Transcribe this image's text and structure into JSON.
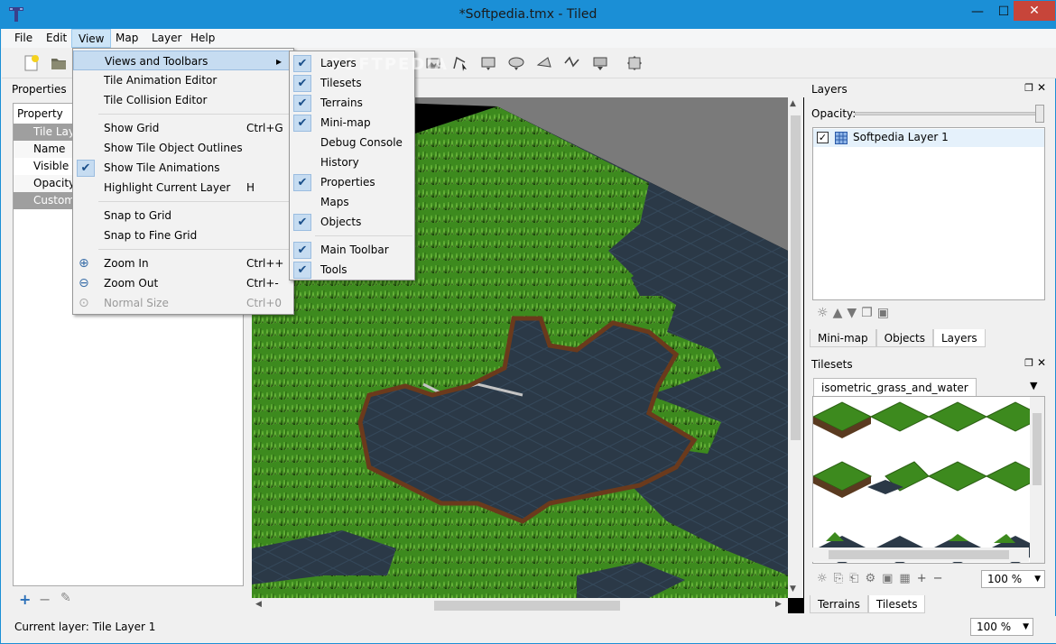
{
  "window": {
    "title": "*Softpedia.tmx - Tiled",
    "minimize": "—",
    "maximize": "☐",
    "close": "✕"
  },
  "menubar": [
    "File",
    "Edit",
    "View",
    "Map",
    "Layer",
    "Help"
  ],
  "watermark": "SOFTPEDIA",
  "properties": {
    "title": "Properties",
    "header": "Property",
    "rows": [
      "Tile Layer",
      "Name",
      "Visible",
      "Opacity",
      "Custom"
    ]
  },
  "view_menu": {
    "items": [
      {
        "label": "Views and Toolbars",
        "shortcut": "",
        "arrow": "▸"
      },
      {
        "label": "Tile Animation Editor",
        "shortcut": ""
      },
      {
        "label": "Tile Collision Editor",
        "shortcut": ""
      },
      {
        "label": "Show Grid",
        "shortcut": "Ctrl+G"
      },
      {
        "label": "Show Tile Object Outlines",
        "shortcut": ""
      },
      {
        "label": "Show Tile Animations",
        "shortcut": "",
        "checked": true
      },
      {
        "label": "Highlight Current Layer",
        "shortcut": "H"
      },
      {
        "label": "Snap to Grid",
        "shortcut": ""
      },
      {
        "label": "Snap to Fine Grid",
        "shortcut": ""
      },
      {
        "label": "Zoom In",
        "shortcut": "Ctrl++"
      },
      {
        "label": "Zoom Out",
        "shortcut": "Ctrl+-"
      },
      {
        "label": "Normal Size",
        "shortcut": "Ctrl+0",
        "disabled": true
      }
    ]
  },
  "submenu": {
    "items": [
      {
        "label": "Layers",
        "checked": true
      },
      {
        "label": "Tilesets",
        "checked": true
      },
      {
        "label": "Terrains",
        "checked": true
      },
      {
        "label": "Mini-map",
        "checked": true
      },
      {
        "label": "Debug Console",
        "checked": false
      },
      {
        "label": "History",
        "checked": false
      },
      {
        "label": "Properties",
        "checked": true
      },
      {
        "label": "Maps",
        "checked": false
      },
      {
        "label": "Objects",
        "checked": true
      },
      {
        "label": "Main Toolbar",
        "checked": true
      },
      {
        "label": "Tools",
        "checked": true
      }
    ]
  },
  "layers_panel": {
    "title": "Layers",
    "opacity_label": "Opacity:",
    "opacity": 1.0,
    "layer_name": "Softpedia Layer 1",
    "tabs": [
      "Mini-map",
      "Objects",
      "Layers"
    ],
    "active_tab": "Layers"
  },
  "tilesets_panel": {
    "title": "Tilesets",
    "tileset_tab": "isometric_grass_and_water",
    "zoom": "100 %",
    "tabs": [
      "Terrains",
      "Tilesets"
    ],
    "active_tab": "Tilesets"
  },
  "status": {
    "current_layer": "Current layer: Tile Layer 1",
    "zoom": "100 %"
  },
  "colors": {
    "accent": "#1b8fd6",
    "grass": "#3f8c1f",
    "water": "#2c3a48",
    "menu_highlight": "#c6dcf1"
  }
}
